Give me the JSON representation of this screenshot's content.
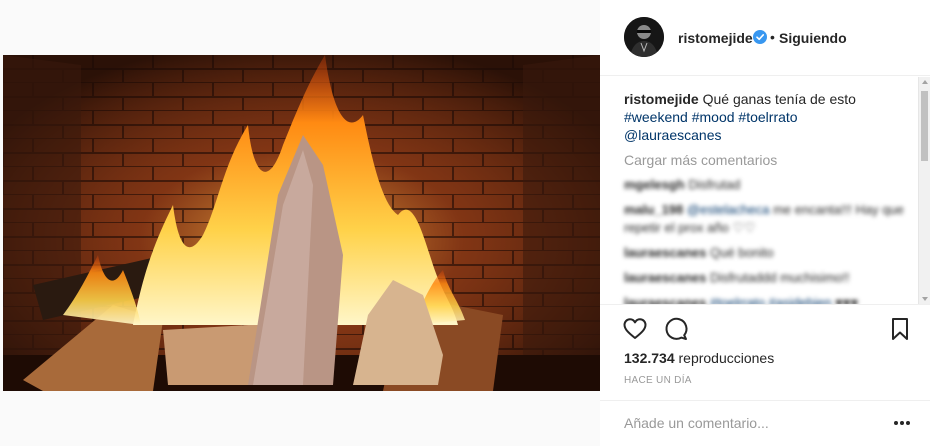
{
  "post": {
    "username": "ristomejide",
    "separator": "•",
    "follow_label": "Siguiendo",
    "verified": true
  },
  "caption": {
    "username": "ristomejide",
    "text": " Qué ganas tenía de esto ",
    "hashtags": [
      "#weekend",
      "#mood",
      "#toelrrato"
    ],
    "mention": "@lauraescanes"
  },
  "load_more": "Cargar más comentarios",
  "comments": [
    {
      "user": "mgelesgh",
      "text": "Disfrutad"
    },
    {
      "user": "malu_198",
      "mention": "@estelacheca",
      "text": " me encanta!!! Hay que repetir el prox año ♡♡"
    },
    {
      "user": "lauraescanes",
      "text": "Qué bonito"
    },
    {
      "user": "lauraescanes",
      "text": "Disfrutaddd muchisimo!!"
    },
    {
      "user": "lauraescanes",
      "mention": "#toelrrato #asidebien",
      "text": " ♥♥♥"
    }
  ],
  "stats": {
    "views": "132.734",
    "views_label": " reproducciones",
    "timestamp": "HACE UN DÍA"
  },
  "add_comment": {
    "placeholder": "Añade un comentario..."
  },
  "icons": {
    "like": "heart-icon",
    "comment": "comment-bubble-icon",
    "save": "bookmark-icon",
    "more": "more-options-icon",
    "verified": "verified-badge-icon"
  },
  "colors": {
    "verified": "#3897f0",
    "link": "#003569",
    "muted": "#999999",
    "text": "#262626"
  }
}
